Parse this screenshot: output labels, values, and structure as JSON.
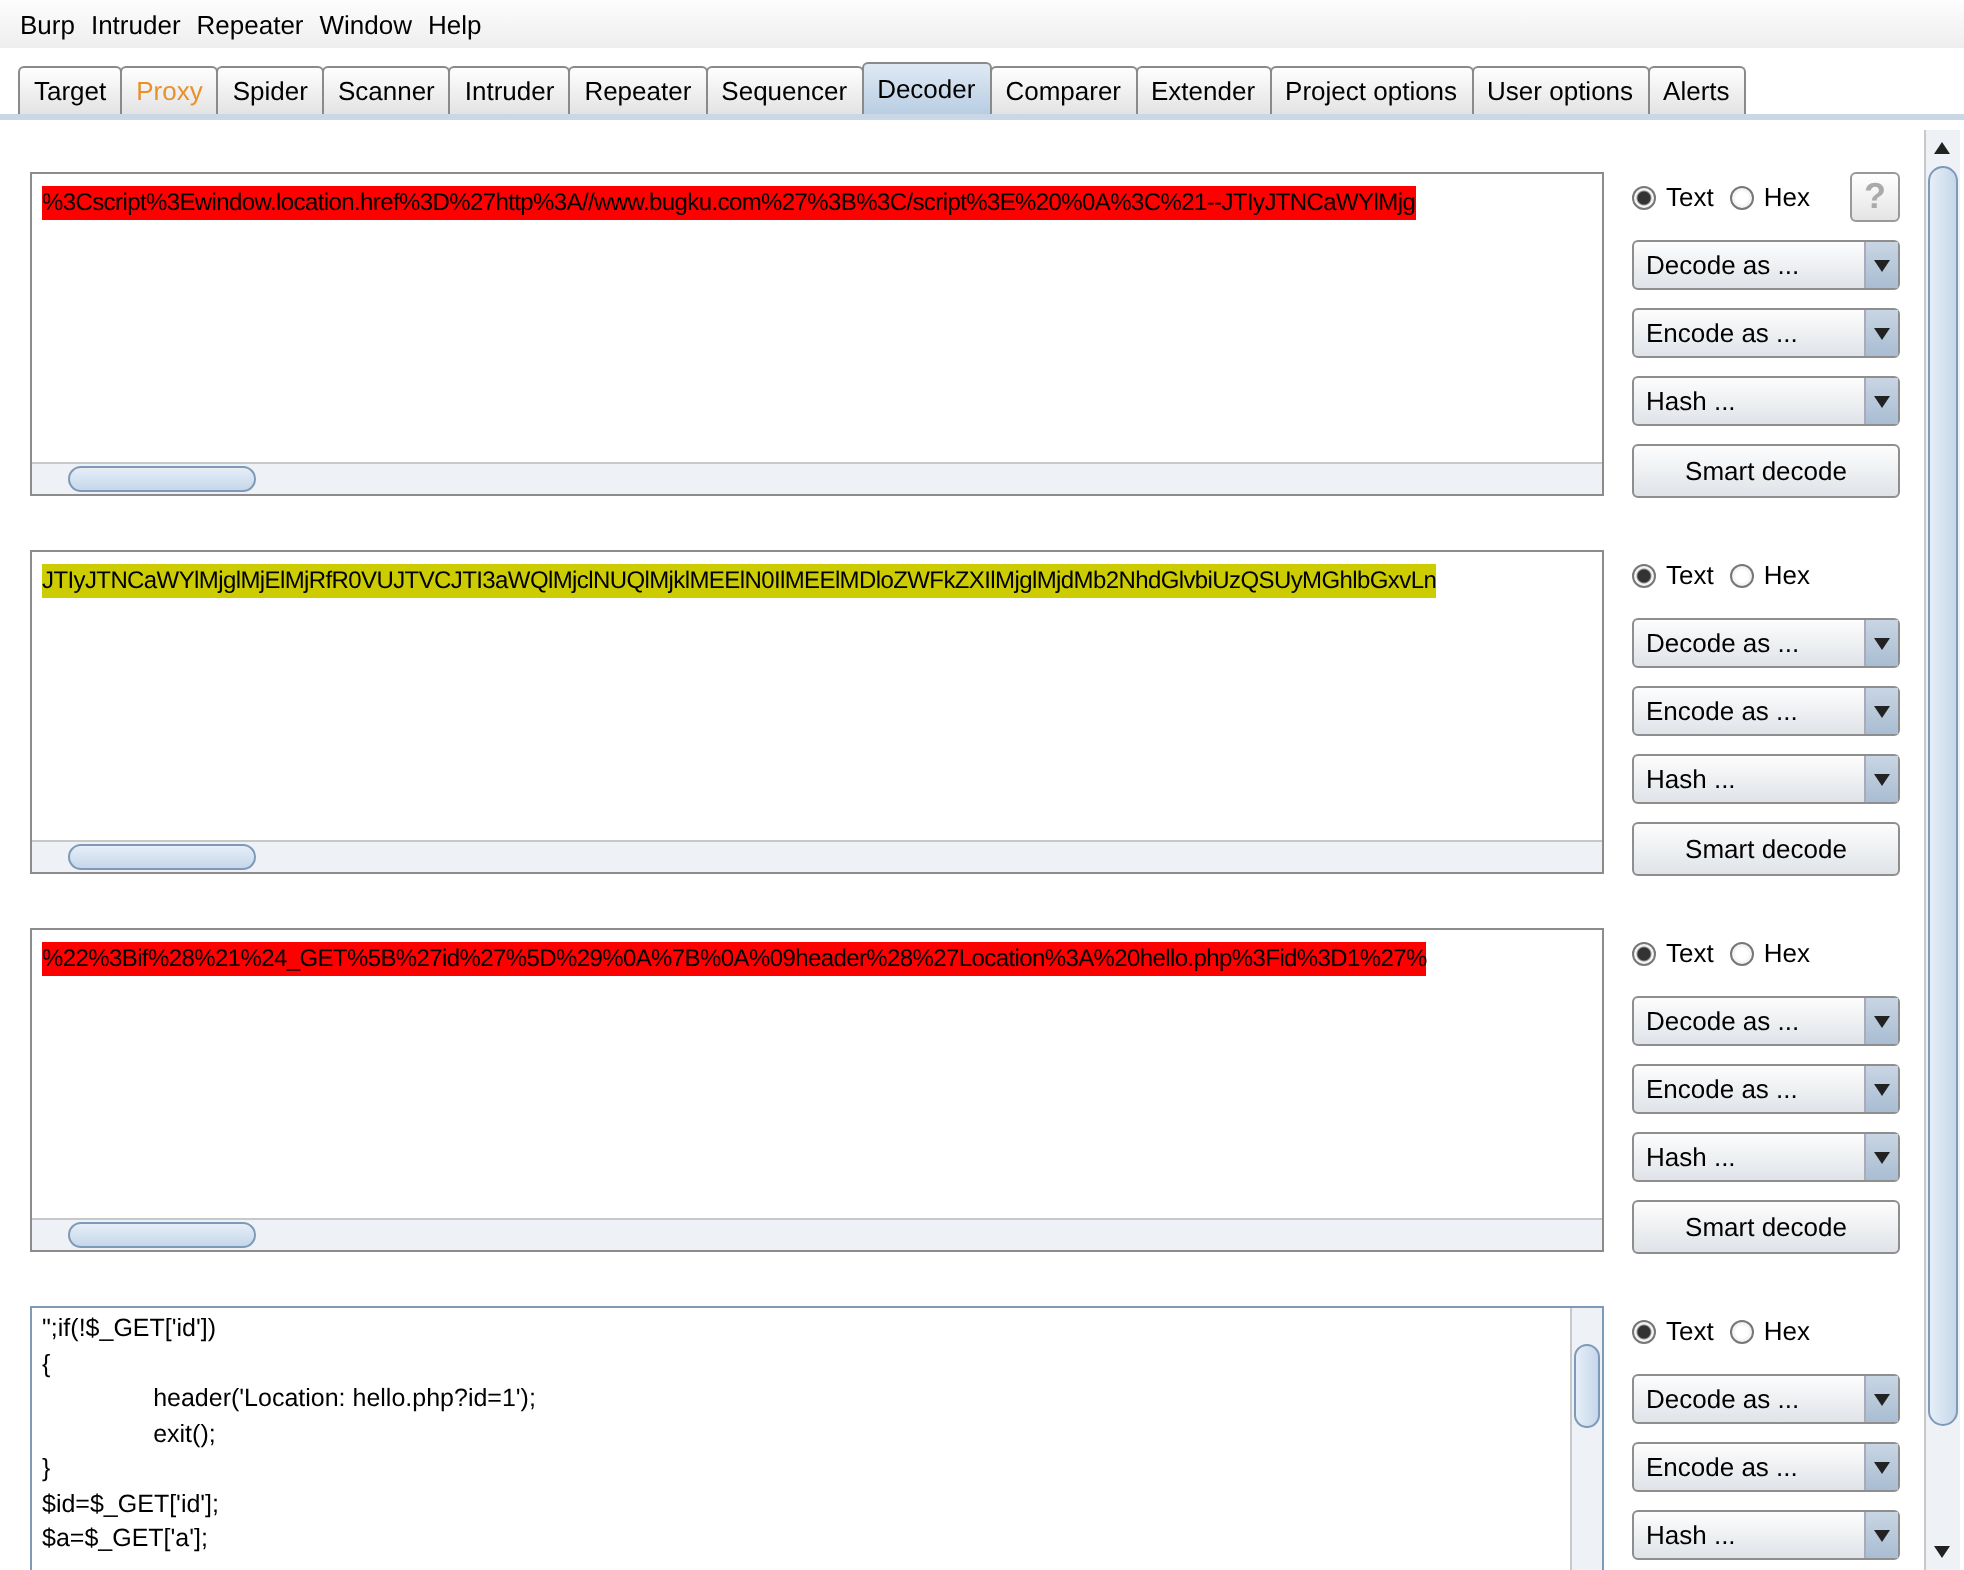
{
  "menu": [
    "Burp",
    "Intruder",
    "Repeater",
    "Window",
    "Help"
  ],
  "tabs": [
    {
      "label": "Target",
      "selected": false,
      "highlighted": false
    },
    {
      "label": "Proxy",
      "selected": false,
      "highlighted": true
    },
    {
      "label": "Spider",
      "selected": false,
      "highlighted": false
    },
    {
      "label": "Scanner",
      "selected": false,
      "highlighted": false
    },
    {
      "label": "Intruder",
      "selected": false,
      "highlighted": false
    },
    {
      "label": "Repeater",
      "selected": false,
      "highlighted": false
    },
    {
      "label": "Sequencer",
      "selected": false,
      "highlighted": false
    },
    {
      "label": "Decoder",
      "selected": true,
      "highlighted": false
    },
    {
      "label": "Comparer",
      "selected": false,
      "highlighted": false
    },
    {
      "label": "Extender",
      "selected": false,
      "highlighted": false
    },
    {
      "label": "Project options",
      "selected": false,
      "highlighted": false
    },
    {
      "label": "User options",
      "selected": false,
      "highlighted": false
    },
    {
      "label": "Alerts",
      "selected": false,
      "highlighted": false
    }
  ],
  "panels": [
    {
      "lines": [
        "%3Cscript%3Ewindow.location.href%3D%27http%3A//www.bugku.com%27%3B%3C/script%3E%20%0A%3C%21--JTIyJTNCaWYlMjg"
      ],
      "color": "#ff0000",
      "format": [
        {
          "label": "Text",
          "selected": true
        },
        {
          "label": "Hex",
          "selected": false
        }
      ],
      "help": "?",
      "selects": [
        "Decode as ...",
        "Encode as ...",
        "Hash ..."
      ],
      "button": "Smart decode"
    },
    {
      "lines": [
        "JTIyJTNCaWYlMjglMjElMjRfR0VUJTVCJTI3aWQlMjclNUQlMjklMEElN0IlMEElMDloZWFkZXIlMjglMjdMb2NhdGlvbiUzQSUyMGhlbGxvLn"
      ],
      "color": "#cccc00",
      "format": [
        {
          "label": "Text",
          "selected": true
        },
        {
          "label": "Hex",
          "selected": false
        }
      ],
      "selects": [
        "Decode as ...",
        "Encode as ...",
        "Hash ..."
      ],
      "button": "Smart decode"
    },
    {
      "lines": [
        "%22%3Bif%28%21%24_GET%5B%27id%27%5D%29%0A%7B%0A%09header%28%27Location%3A%20hello.php%3Fid%3D1%27%"
      ],
      "color": "#ff0000",
      "format": [
        {
          "label": "Text",
          "selected": true
        },
        {
          "label": "Hex",
          "selected": false
        }
      ],
      "selects": [
        "Decode as ...",
        "Encode as ...",
        "Hash ..."
      ],
      "button": "Smart decode"
    },
    {
      "lines": [
        "\";if(!$_GET['id'])",
        "{",
        "\theader('Location: hello.php?id=1');",
        "\texit();",
        "}",
        "$id=$_GET['id'];",
        "$a=$_GET['a'];"
      ],
      "format": [
        {
          "label": "Text",
          "selected": true
        },
        {
          "label": "Hex",
          "selected": false
        }
      ],
      "selects": [
        "Decode as ...",
        "Encode as ...",
        "Hash ..."
      ]
    }
  ]
}
